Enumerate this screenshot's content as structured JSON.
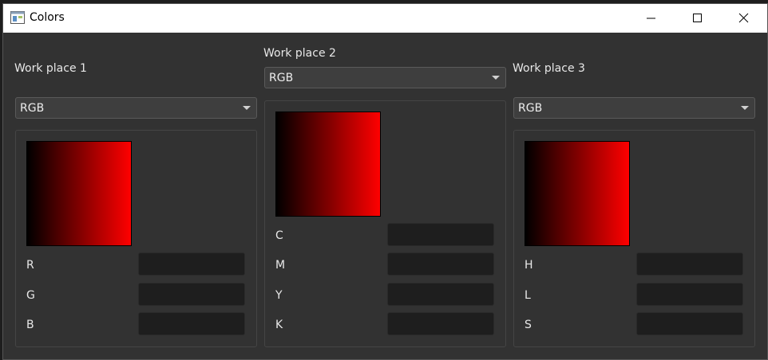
{
  "window": {
    "title": "Colors",
    "app_icon": "window-app-icon",
    "controls": {
      "minimize": "minimize-icon",
      "maximize": "maximize-icon",
      "close": "close-icon"
    }
  },
  "workplaces": [
    {
      "label": "Work place 1",
      "mode": "RGB",
      "swatch_gradient": [
        "#000000",
        "#ff0000"
      ],
      "fields": [
        {
          "label": "R",
          "value": ""
        },
        {
          "label": "G",
          "value": ""
        },
        {
          "label": "B",
          "value": ""
        }
      ]
    },
    {
      "label": "Work place 2",
      "mode": "RGB",
      "swatch_gradient": [
        "#000000",
        "#ff0000"
      ],
      "fields": [
        {
          "label": "C",
          "value": ""
        },
        {
          "label": "M",
          "value": ""
        },
        {
          "label": "Y",
          "value": ""
        },
        {
          "label": "K",
          "value": ""
        }
      ]
    },
    {
      "label": "Work place 3",
      "mode": "RGB",
      "swatch_gradient": [
        "#000000",
        "#ff0000"
      ],
      "fields": [
        {
          "label": "H",
          "value": ""
        },
        {
          "label": "L",
          "value": ""
        },
        {
          "label": "S",
          "value": ""
        }
      ]
    }
  ],
  "colors": {
    "background": "#323232",
    "input_background": "#1e1e1e",
    "combo_background": "#3e3e3e",
    "text": "#e8e8e8"
  }
}
